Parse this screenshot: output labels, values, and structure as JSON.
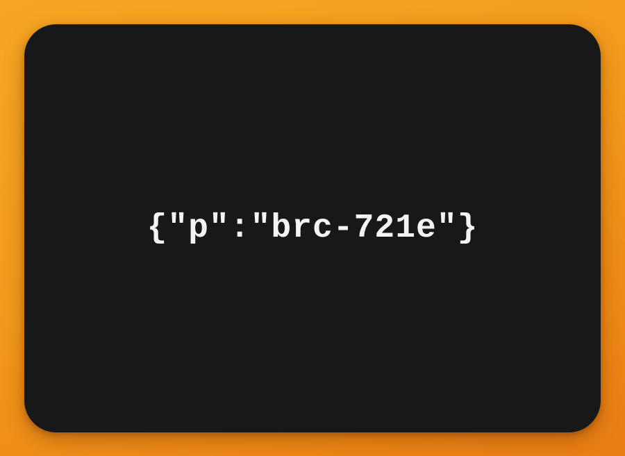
{
  "card": {
    "text": "{\"p\":\"brc-721e\"}"
  },
  "colors": {
    "background_top": "#f6a623",
    "background_bottom": "#e97d14",
    "card": "#17181a",
    "text": "#f4f4f4"
  }
}
